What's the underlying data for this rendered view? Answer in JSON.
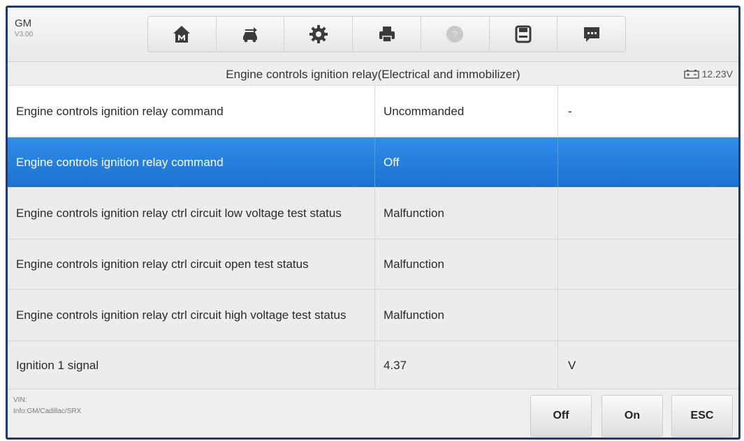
{
  "header": {
    "make": "GM",
    "version": "V3.00"
  },
  "toolbar": {
    "icons": [
      "home-icon",
      "vehicle-swap-icon",
      "gear-icon",
      "printer-icon",
      "help-icon",
      "save-icon",
      "message-icon"
    ]
  },
  "titlebar": {
    "title": "Engine controls ignition relay(Electrical and immobilizer)",
    "voltage": "12.23V"
  },
  "table": {
    "rows": [
      {
        "name": "Engine controls ignition relay command",
        "value": "Uncommanded",
        "unit": "-"
      },
      {
        "name": "Engine controls ignition relay command",
        "value": "Off",
        "unit": ""
      },
      {
        "name": "Engine controls ignition relay ctrl circuit low voltage test status",
        "value": "Malfunction",
        "unit": ""
      },
      {
        "name": "Engine controls ignition relay ctrl circuit open test status",
        "value": "Malfunction",
        "unit": ""
      },
      {
        "name": "Engine controls ignition relay ctrl circuit high voltage test status",
        "value": "Malfunction",
        "unit": ""
      },
      {
        "name": "Ignition 1 signal",
        "value": "4.37",
        "unit": "V"
      }
    ]
  },
  "footer": {
    "vin_label": "VIN:",
    "info": "Info:GM/Cadillac/SRX",
    "buttons": {
      "off": "Off",
      "on": "On",
      "esc": "ESC"
    }
  },
  "colors": {
    "selected_row": "#1d72d1",
    "frame_border": "#1c3b73"
  }
}
